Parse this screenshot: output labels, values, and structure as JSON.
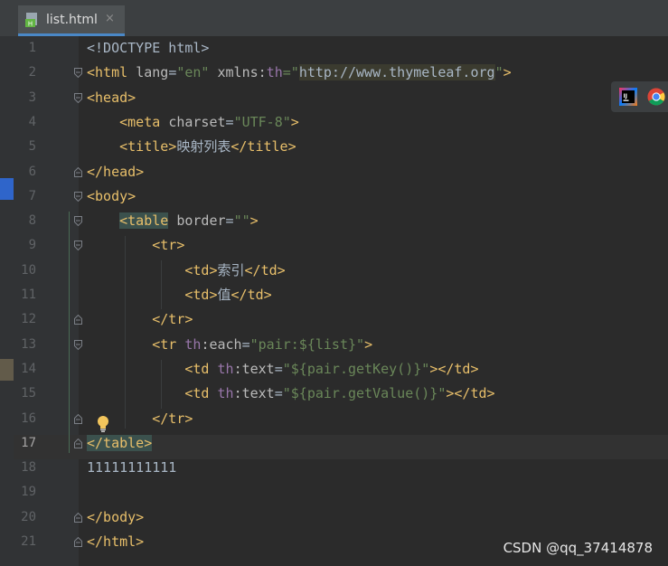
{
  "editor_tab": {
    "filename": "list.html",
    "close_glyph": "×"
  },
  "lines": [
    {
      "n": "1",
      "segments": [
        {
          "t": "<!DOCTYPE html>",
          "c": "txt"
        }
      ]
    },
    {
      "n": "2",
      "segments": [
        {
          "t": "<html ",
          "c": "tag"
        },
        {
          "t": "lang",
          "c": "attr"
        },
        {
          "t": "=",
          "c": "txt"
        },
        {
          "t": "\"en\"",
          "c": "val"
        },
        {
          "t": " ",
          "c": "txt"
        },
        {
          "t": "xmlns:",
          "c": "attr"
        },
        {
          "t": "th",
          "c": "ns"
        },
        {
          "t": "=\"",
          "c": "val"
        },
        {
          "t": "http://www.thymeleaf.org",
          "c": "url"
        },
        {
          "t": "\"",
          "c": "val"
        },
        {
          "t": ">",
          "c": "tag"
        }
      ]
    },
    {
      "n": "3",
      "segments": [
        {
          "t": "<head>",
          "c": "tag"
        }
      ]
    },
    {
      "n": "4",
      "segments": [
        {
          "t": "    ",
          "c": "txt"
        },
        {
          "t": "<meta ",
          "c": "tag"
        },
        {
          "t": "charset",
          "c": "attr"
        },
        {
          "t": "=",
          "c": "txt"
        },
        {
          "t": "\"UTF-8\"",
          "c": "val"
        },
        {
          "t": ">",
          "c": "tag"
        }
      ]
    },
    {
      "n": "5",
      "segments": [
        {
          "t": "    ",
          "c": "txt"
        },
        {
          "t": "<title>",
          "c": "tag"
        },
        {
          "t": "映射列表",
          "c": "txt"
        },
        {
          "t": "</title>",
          "c": "tag"
        }
      ]
    },
    {
      "n": "6",
      "segments": [
        {
          "t": "</head>",
          "c": "tag"
        }
      ]
    },
    {
      "n": "7",
      "segments": [
        {
          "t": "<body>",
          "c": "tag"
        }
      ]
    },
    {
      "n": "8",
      "segments": [
        {
          "t": "    ",
          "c": "txt"
        },
        {
          "t": "<table",
          "c": "tag hl-tag"
        },
        {
          "t": " ",
          "c": "tag"
        },
        {
          "t": "border",
          "c": "attr"
        },
        {
          "t": "=",
          "c": "txt"
        },
        {
          "t": "\"\"",
          "c": "val"
        },
        {
          "t": ">",
          "c": "tag"
        }
      ]
    },
    {
      "n": "9",
      "segments": [
        {
          "t": "        ",
          "c": "txt"
        },
        {
          "t": "<tr>",
          "c": "tag"
        }
      ]
    },
    {
      "n": "10",
      "segments": [
        {
          "t": "            ",
          "c": "txt"
        },
        {
          "t": "<td>",
          "c": "tag"
        },
        {
          "t": "索引",
          "c": "txt"
        },
        {
          "t": "</td>",
          "c": "tag"
        }
      ]
    },
    {
      "n": "11",
      "segments": [
        {
          "t": "            ",
          "c": "txt"
        },
        {
          "t": "<td>",
          "c": "tag"
        },
        {
          "t": "值",
          "c": "txt"
        },
        {
          "t": "</td>",
          "c": "tag"
        }
      ]
    },
    {
      "n": "12",
      "segments": [
        {
          "t": "        ",
          "c": "txt"
        },
        {
          "t": "</tr>",
          "c": "tag"
        }
      ]
    },
    {
      "n": "13",
      "segments": [
        {
          "t": "        ",
          "c": "txt"
        },
        {
          "t": "<tr ",
          "c": "tag"
        },
        {
          "t": "th",
          "c": "ns"
        },
        {
          "t": ":each",
          "c": "attr"
        },
        {
          "t": "=",
          "c": "txt"
        },
        {
          "t": "\"pair:${list}\"",
          "c": "val"
        },
        {
          "t": ">",
          "c": "tag"
        }
      ]
    },
    {
      "n": "14",
      "segments": [
        {
          "t": "            ",
          "c": "txt"
        },
        {
          "t": "<td ",
          "c": "tag"
        },
        {
          "t": "th",
          "c": "ns"
        },
        {
          "t": ":text",
          "c": "attr"
        },
        {
          "t": "=",
          "c": "txt"
        },
        {
          "t": "\"${pair.getKey()}\"",
          "c": "val"
        },
        {
          "t": "></td>",
          "c": "tag"
        }
      ]
    },
    {
      "n": "15",
      "segments": [
        {
          "t": "            ",
          "c": "txt"
        },
        {
          "t": "<td ",
          "c": "tag"
        },
        {
          "t": "th",
          "c": "ns"
        },
        {
          "t": ":text",
          "c": "attr"
        },
        {
          "t": "=",
          "c": "txt"
        },
        {
          "t": "\"${pair.getValue()}\"",
          "c": "val"
        },
        {
          "t": "></td>",
          "c": "tag"
        }
      ]
    },
    {
      "n": "16",
      "segments": [
        {
          "t": "        ",
          "c": "txt"
        },
        {
          "t": "</tr>",
          "c": "tag"
        }
      ]
    },
    {
      "n": "17",
      "segments": [
        {
          "t": "</table>",
          "c": "tag hl-tag-current"
        }
      ],
      "current": true
    },
    {
      "n": "18",
      "segments": [
        {
          "t": "11111111111",
          "c": "txt"
        }
      ]
    },
    {
      "n": "19",
      "segments": []
    },
    {
      "n": "20",
      "segments": [
        {
          "t": "</body>",
          "c": "tag"
        }
      ]
    },
    {
      "n": "21",
      "segments": [
        {
          "t": "</html>",
          "c": "tag"
        }
      ]
    }
  ],
  "floating_toolbar": {
    "icons": [
      "intellij-idea-icon",
      "chrome-icon"
    ]
  },
  "watermark": "CSDN @qq_37414878",
  "colors": {
    "tag": "#e8bf6a",
    "attribute": "#bababa",
    "string": "#6a8759",
    "namespace": "#9876aa",
    "text": "#a9b7c6",
    "background": "#2b2b2b"
  }
}
